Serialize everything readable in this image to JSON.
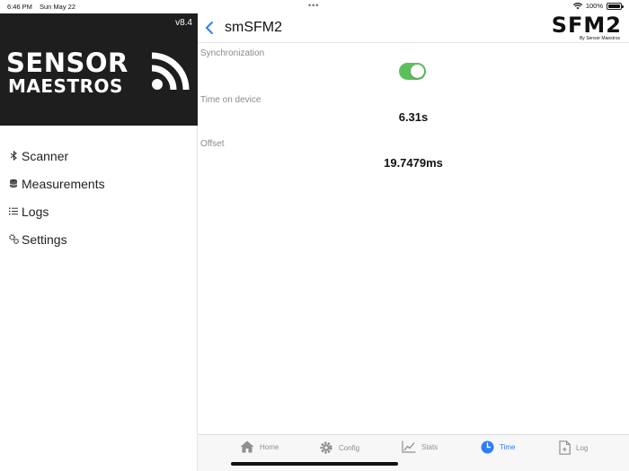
{
  "status_bar": {
    "time": "6:46 PM",
    "date": "Sun May 22",
    "battery": "100%"
  },
  "sidebar": {
    "version": "v8.4",
    "logo": {
      "line1": "SENSOR",
      "line2": "MAESTROS"
    },
    "items": [
      {
        "label": "Scanner",
        "icon": "bluetooth-icon"
      },
      {
        "label": "Measurements",
        "icon": "database-icon"
      },
      {
        "label": "Logs",
        "icon": "list-icon"
      },
      {
        "label": "Settings",
        "icon": "gears-icon"
      }
    ]
  },
  "header": {
    "title": "smSFM2",
    "brand": "SFM2",
    "brand_sub": "By Sensor Maestros"
  },
  "content": {
    "sync_label": "Synchronization",
    "sync_enabled": true,
    "time_label": "Time on device",
    "time_value": "6.31s",
    "offset_label": "Offset",
    "offset_value": "19.7479ms"
  },
  "tabs": [
    {
      "label": "Home",
      "icon": "home-icon",
      "active": false
    },
    {
      "label": "Config",
      "icon": "gear-icon",
      "active": false
    },
    {
      "label": "Stats",
      "icon": "line-chart-icon",
      "active": false
    },
    {
      "label": "Time",
      "icon": "clock-icon",
      "active": true
    },
    {
      "label": "Log",
      "icon": "document-icon",
      "active": false
    }
  ],
  "colors": {
    "accent": "#2f7df6",
    "toggle_on": "#5cc05a",
    "logo_bg": "#1e1e1e"
  }
}
